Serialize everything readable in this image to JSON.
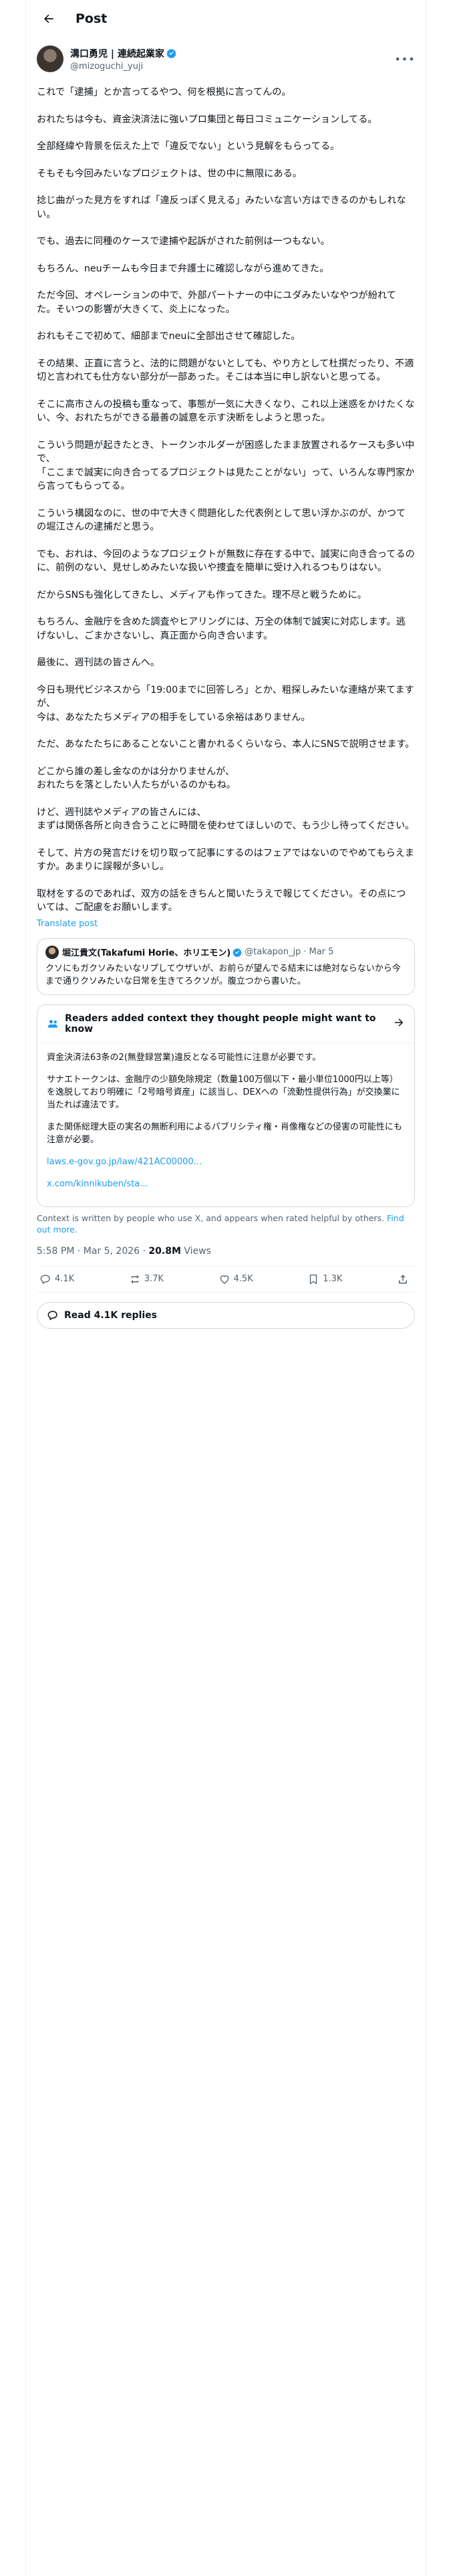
{
  "header": {
    "title": "Post"
  },
  "author": {
    "name": "溝口勇児 | 連続起業家",
    "handle": "@mizoguchi_yuji"
  },
  "post": {
    "paragraphs": [
      "これで「逮捕」とか言ってるやつ、何を根拠に言ってんの。",
      "おれたちは今も、資金決済法に強いプロ集団と毎日コミュニケーションしてる。",
      "全部経緯や背景を伝えた上で「違反でない」という見解をもらってる。",
      "そもそも今回みたいなプロジェクトは、世の中に無限にある。",
      "捻じ曲がった見方をすれば「違反っぽく見える」みたいな言い方はできるのかもしれない。",
      "でも、過去に同種のケースで逮捕や起訴がされた前例は一つもない。",
      "もちろん、neuチームも今日まで弁護士に確認しながら進めてきた。",
      "ただ今回、オペレーションの中で、外部パートナーの中にユダみたいなやつが紛れてた。そいつの影響が大きくて、炎上になった。",
      "おれもそこで初めて、細部までneuに全部出させて確認した。",
      "その結果、正直に言うと、法的に問題がないとしても、やり方として杜撰だったり、不適切と言われても仕方ない部分が一部あった。そこは本当に申し訳ないと思ってる。",
      "そこに高市さんの投稿も重なって、事態が一気に大きくなり、これ以上迷惑をかけたくない、今、おれたちができる最善の誠意を示す決断をしようと思った。",
      "こういう問題が起きたとき、トークンホルダーが困惑したまま放置されるケースも多い中で、\n「ここまで誠実に向き合ってるプロジェクトは見たことがない」って、いろんな専門家から言ってもらってる。",
      "こういう構図なのに、世の中で大きく問題化した代表例として思い浮かぶのが、かつての堀江さんの逮捕だと思う。",
      "でも、おれは、今回のようなプロジェクトが無数に存在する中で、誠実に向き合ってるのに、前例のない、見せしめみたいな扱いや捜査を簡単に受け入れるつもりはない。",
      "だからSNSも強化してきたし、メディアも作ってきた。理不尽と戦うために。",
      "もちろん、金融庁を含めた調査やヒアリングには、万全の体制で誠実に対応します。逃げないし、ごまかさないし、真正面から向き合います。",
      "最後に、週刊誌の皆さんへ。",
      "今日も現代ビジネスから「19:00までに回答しろ」とか、粗探しみたいな連絡が来てますが、\n今は、あなたたちメディアの相手をしている余裕はありません。",
      "ただ、あなたたちにあることないこと書かれるくらいなら、本人にSNSで説明させます。",
      "どこから誰の差し金なのかは分かりませんが、\nおれたちを落としたい人たちがいるのかもね。",
      "けど、週刊誌やメディアの皆さんには、\nまずは関係各所と向き合うことに時間を使わせてほしいので、もう少し待ってください。",
      "そして、片方の発言だけを切り取って記事にするのはフェアではないのでやめてもらえますか。あまりに誤報が多いし。",
      "取材をするのであれば、双方の話をきちんと聞いたうえで報じてください。その点については、ご配慮をお願いします。"
    ],
    "translate_label": "Translate post"
  },
  "quote": {
    "name": "堀江貴文(Takafumi Horie、ホリエモン)",
    "handle": "@takapon_jp",
    "separator": "·",
    "date": "Mar 5",
    "text": "クソにもガクソみたいなリプしてウザいが、お前らが望んでる結末には絶対ならないから今まで通りクソみたいな日常を生きてろクソが。腹立つから書いた。"
  },
  "community_notes": {
    "title": "Readers added context they thought people might want to know",
    "paragraphs": [
      "資金決済法63条の2(無登録営業)違反となる可能性に注意が必要です。",
      "サナエトークンは、金融庁の少額免除規定（数量100万個以下・最小単位1000円以上等）を逸脱しており明確に「2号暗号資産」に該当し、DEXへの「流動性提供行為」が交換業に当たれば違法です。",
      "また関係総理大臣の実名の無断利用によるパブリシティ権・肖像権などの侵害の可能性にも注意が必要。"
    ],
    "links": [
      "laws.e-gov.go.jp/law/421AC00000...",
      "x.com/kinnikuben/sta..."
    ],
    "footer_text": "Context is written by people who use X, and appears when rated helpful by others.",
    "footer_link": "Find out more."
  },
  "meta": {
    "time": "5:58 PM · Mar 5, 2026",
    "dot": "·",
    "views_count": "20.8M",
    "views_label": "Views"
  },
  "actions": {
    "replies": "4.1K",
    "reposts": "3.7K",
    "likes": "4.5K",
    "bookmarks": "1.3K"
  },
  "read_replies": {
    "label": "Read 4.1K replies"
  },
  "colors": {
    "accent": "#1d9bf0",
    "text": "#0f1419",
    "muted": "#536471",
    "border": "#cfd9de"
  }
}
